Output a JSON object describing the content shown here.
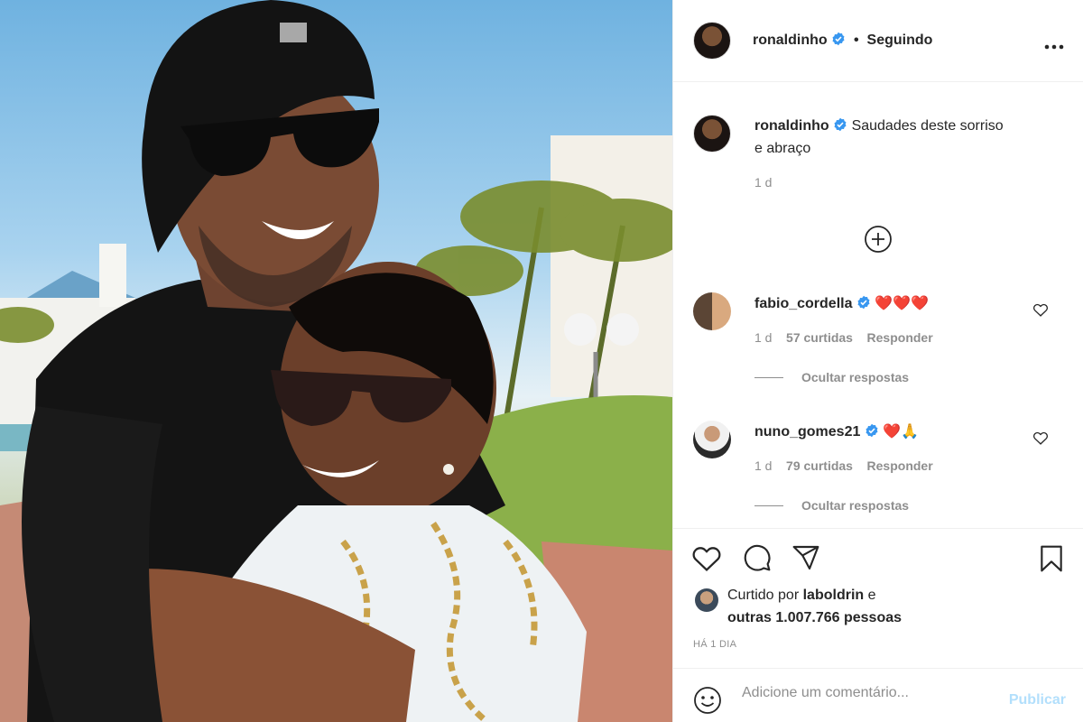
{
  "post": {
    "author": "ronaldinho",
    "follow_status": "Seguindo",
    "more_label": "•••"
  },
  "caption": {
    "username": "ronaldinho",
    "text_line1": "Saudades deste sorriso",
    "text_line2": "e abraço",
    "time": "1 d"
  },
  "comments": [
    {
      "username": "fabio_cordella",
      "text": "❤️❤️❤️",
      "time": "1 d",
      "likes": "57 curtidas",
      "reply": "Responder",
      "hide_replies": "Ocultar respostas"
    },
    {
      "username": "nuno_gomes21",
      "text": "❤️🙏",
      "time": "1 d",
      "likes": "79 curtidas",
      "reply": "Responder",
      "hide_replies": "Ocultar respostas"
    }
  ],
  "likes": {
    "prefix": "Curtido por",
    "user": "laboldrin",
    "conj": "e",
    "others": "outras 1.007.766 pessoas",
    "posted_ago": "HÁ 1 DIA"
  },
  "comment_box": {
    "placeholder": "Adicione um comentário...",
    "publish_label": "Publicar"
  },
  "colors": {
    "verified": "#3897f0",
    "heart": "#ed4956",
    "publish_disabled": "#b2dffc",
    "secondary_text": "#8e8e8e"
  },
  "icons": [
    "verified-icon",
    "more-icon",
    "plus-circle-icon",
    "heart-icon",
    "comment-icon",
    "share-icon",
    "bookmark-icon",
    "emoji-icon"
  ]
}
